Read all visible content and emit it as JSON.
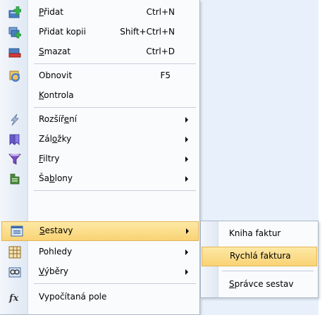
{
  "menu": {
    "items": [
      {
        "label": "Přidat",
        "shortcut": "Ctrl+N",
        "icon": "add-record-icon",
        "has_submenu": false
      },
      {
        "label": "Přidat kopii",
        "shortcut": "Shift+Ctrl+N",
        "icon": "add-copy-icon",
        "has_submenu": false
      },
      {
        "label": "Smazat",
        "shortcut": "Ctrl+D",
        "icon": "delete-record-icon",
        "has_submenu": false
      },
      {
        "label": "Obnovit",
        "shortcut": "F5",
        "icon": "refresh-icon",
        "has_submenu": false
      },
      {
        "label": "Kontrola",
        "shortcut": "",
        "icon": "",
        "has_submenu": false
      },
      {
        "label": "Rozšíření",
        "shortcut": "",
        "icon": "extension-icon",
        "has_submenu": true
      },
      {
        "label": "Záložky",
        "shortcut": "",
        "icon": "bookmarks-icon",
        "has_submenu": true
      },
      {
        "label": "Filtry",
        "shortcut": "",
        "icon": "filter-icon",
        "has_submenu": true
      },
      {
        "label": "Šablony",
        "shortcut": "",
        "icon": "templates-icon",
        "has_submenu": true
      },
      {
        "label": "Sestavy",
        "shortcut": "",
        "icon": "reports-icon",
        "has_submenu": true,
        "selected": true
      },
      {
        "label": "Pohledy",
        "shortcut": "",
        "icon": "views-icon",
        "has_submenu": true
      },
      {
        "label": "Výběry",
        "shortcut": "",
        "icon": "selections-icon",
        "has_submenu": true
      },
      {
        "label": "Vypočítaná pole",
        "shortcut": "",
        "icon": "calculated-field-icon",
        "has_submenu": false
      }
    ]
  },
  "submenu": {
    "items": [
      {
        "label": "Kniha faktur"
      },
      {
        "label": "Rychlá faktura",
        "selected": true
      },
      {
        "label": "Správce sestav"
      }
    ]
  },
  "colors": {
    "highlight_top": "#fde8a5",
    "highlight_bottom": "#f9d374",
    "highlight_border": "#e3b556",
    "menu_background": "#fafbfd",
    "menu_border": "#aab8c9",
    "desktop_background": "#e8f1fb"
  }
}
